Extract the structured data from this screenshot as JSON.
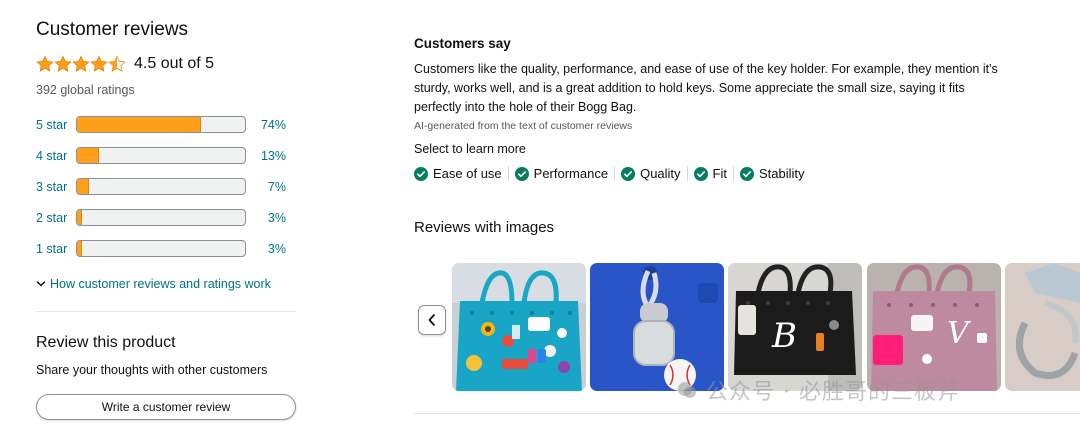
{
  "summary": {
    "title": "Customer reviews",
    "rating_text": "4.5 out of 5",
    "rating_value": 4.5,
    "global_ratings": "392 global ratings",
    "star_color": "#ff9f1a"
  },
  "histogram": [
    {
      "label": "5 star",
      "pct_text": "74%",
      "pct": 74
    },
    {
      "label": "4 star",
      "pct_text": "13%",
      "pct": 13
    },
    {
      "label": "3 star",
      "pct_text": "7%",
      "pct": 7
    },
    {
      "label": "2 star",
      "pct_text": "3%",
      "pct": 3
    },
    {
      "label": "1 star",
      "pct_text": "3%",
      "pct": 3
    }
  ],
  "how_link": "How customer reviews and ratings work",
  "review_product": {
    "title": "Review this product",
    "subtitle": "Share your thoughts with other customers",
    "button": "Write a customer review"
  },
  "customers_say": {
    "title": "Customers say",
    "body": "Customers like the quality, performance, and ease of use of the key holder. For example, they mention it's sturdy, works well, and is a great addition to hold keys. Some appreciate the small size, saying it fits perfectly into the hole of their Bogg Bag.",
    "ai_note": "AI-generated from the text of customer reviews",
    "select_more": "Select to learn more",
    "chips": [
      "Ease of use",
      "Performance",
      "Quality",
      "Fit",
      "Stability"
    ]
  },
  "images": {
    "title": "Reviews with images",
    "prev_icon": "chevron-left-icon"
  },
  "watermark": "公众号 · 必胜哥的三板斧",
  "colors": {
    "link": "#007185",
    "check": "#067d62",
    "bar_fill": "#ff9f1a"
  }
}
